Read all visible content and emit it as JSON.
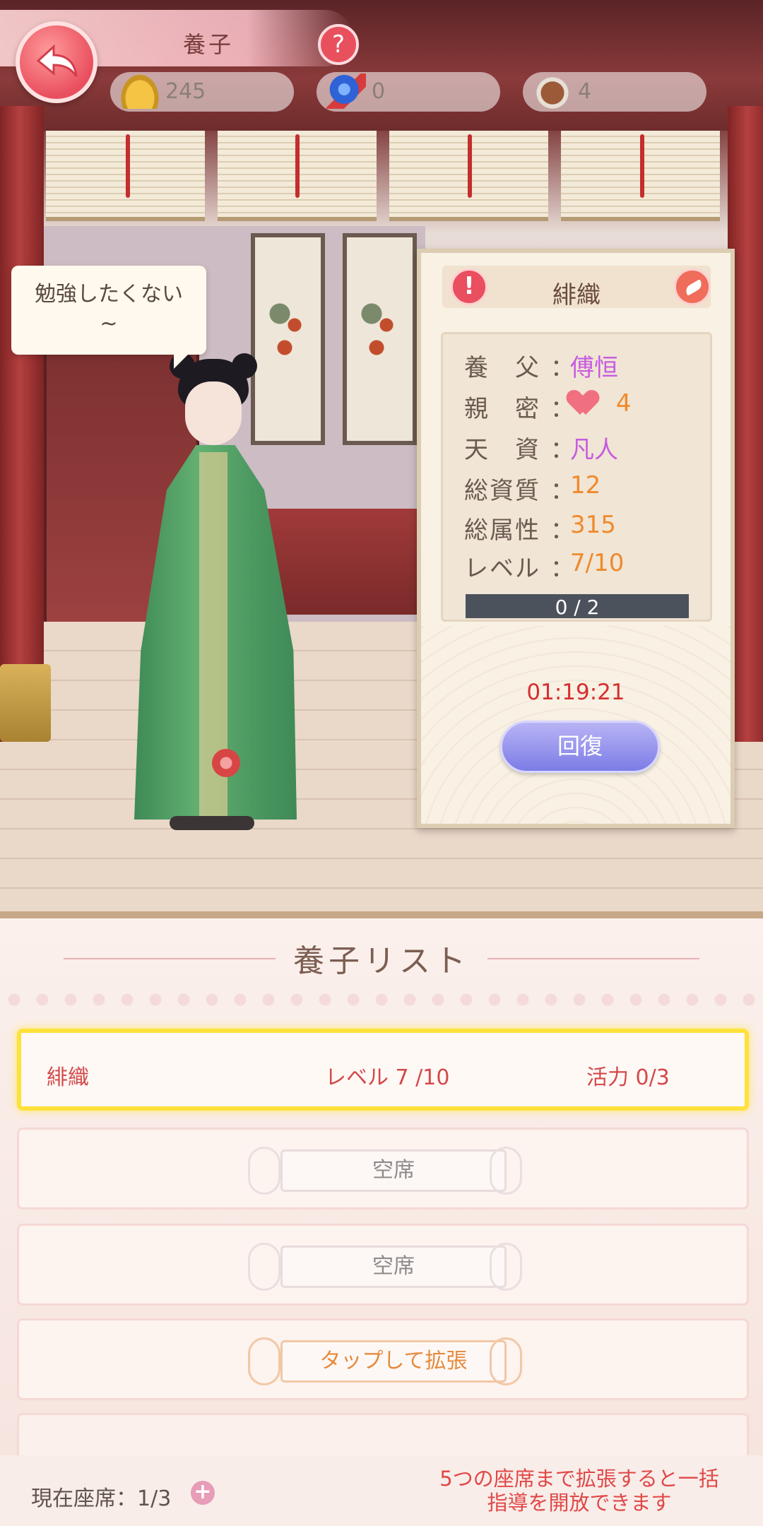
{
  "header": {
    "title": "養子",
    "help_label": "?",
    "currencies": [
      {
        "icon": "gold-ingot-icon",
        "value": "245"
      },
      {
        "icon": "blue-gem-icon",
        "value": "0"
      },
      {
        "icon": "soup-bowl-icon",
        "value": "4"
      }
    ]
  },
  "scene": {
    "speech": [
      "勉強したくない",
      "~"
    ]
  },
  "info_panel": {
    "name": "緋織",
    "warn_label": "!",
    "stats": [
      {
        "label": "養　父",
        "value": "傅恒"
      },
      {
        "label": "親　密",
        "value": "4"
      },
      {
        "label": "天　資",
        "value": "凡人"
      },
      {
        "label": "総資質",
        "value": "12"
      },
      {
        "label": "総属性",
        "value": "315"
      },
      {
        "label": "レベル",
        "value": "7/10"
      }
    ],
    "separator": "：",
    "progress": {
      "text": "0 / 2",
      "fraction": 0
    },
    "timer": "01:19:21",
    "recover_button": "回復"
  },
  "list": {
    "title": "養子リスト",
    "rows": [
      {
        "name": "緋織",
        "level": "レベル 7 /10",
        "vitality": "活力 0/3"
      },
      {
        "slot": "空席"
      },
      {
        "slot": "空席"
      },
      {
        "slot": "タップして拡張"
      }
    ]
  },
  "footer": {
    "current_seats": "現在座席：1/3",
    "plus": "+",
    "hint": "5つの座席まで拡張すると一括指導を開放できます"
  },
  "colors": {
    "accent_red": "#e94f5f",
    "highlight_yellow": "#ffe13b",
    "purple_value": "#c65ce0",
    "orange_value": "#ef8a2c"
  }
}
